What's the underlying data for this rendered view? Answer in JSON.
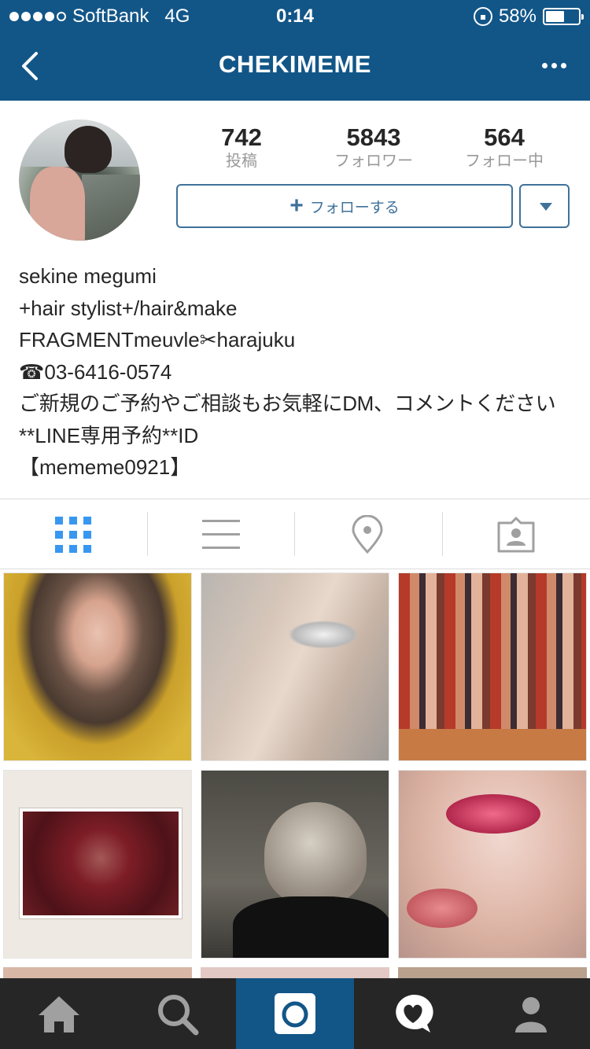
{
  "status_bar": {
    "carrier": "SoftBank",
    "network": "4G",
    "time": "0:14",
    "battery": "58%",
    "battery_level": 0.58
  },
  "nav": {
    "title": "CHEKIMEME",
    "back_icon": "chevron-left-icon",
    "more_icon": "ellipsis-icon"
  },
  "profile": {
    "stats": [
      {
        "value": "742",
        "label": "投稿"
      },
      {
        "value": "5843",
        "label": "フォロワー"
      },
      {
        "value": "564",
        "label": "フォロー中"
      }
    ],
    "follow_button": "フォローする",
    "follow_icon": "plus-icon",
    "dropdown_icon": "triangle-down-icon"
  },
  "bio": {
    "name": "sekine megumi",
    "lines": [
      "+hair stylist+/hair&make",
      "FRAGMENTmeuvle✂harajuku",
      "☎03-6416-0574",
      "ご新規のご予約やご相談もお気軽にDM、コメントください",
      "**LINE専用予約**ID",
      "【mememe0921】"
    ]
  },
  "view_tabs": [
    {
      "name": "grid-icon",
      "active": true
    },
    {
      "name": "list-icon",
      "active": false
    },
    {
      "name": "location-pin-icon",
      "active": false
    },
    {
      "name": "tagged-person-icon",
      "active": false
    }
  ],
  "tab_bar": [
    {
      "name": "home-icon",
      "active": false
    },
    {
      "name": "search-icon",
      "active": false
    },
    {
      "name": "camera-icon",
      "active": true
    },
    {
      "name": "activity-heart-icon",
      "active": false
    },
    {
      "name": "profile-icon",
      "active": false
    }
  ],
  "colors": {
    "brand": "#125688",
    "accent": "#3897f0",
    "button": "#3f729b",
    "tabbar": "#262626"
  }
}
